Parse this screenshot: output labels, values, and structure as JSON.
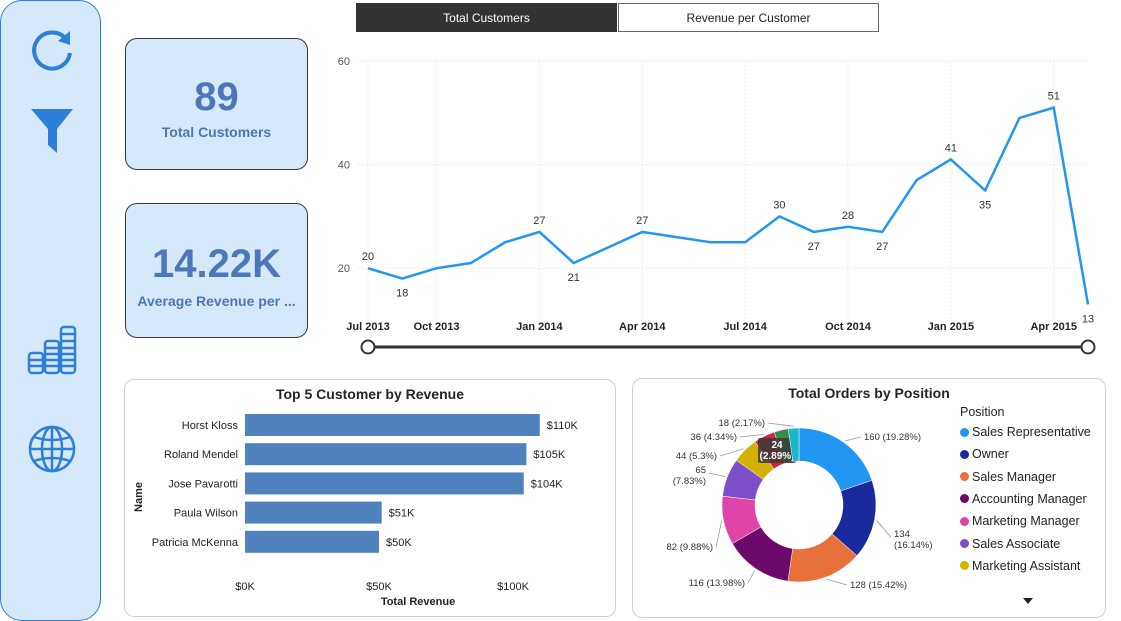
{
  "sidebar": {
    "icons": [
      {
        "name": "refresh-icon"
      },
      {
        "name": "filter-icon"
      },
      {
        "name": "coins-icon"
      },
      {
        "name": "globe-icon"
      }
    ]
  },
  "kpi": {
    "customers": {
      "value": "89",
      "label": "Total Customers"
    },
    "avg_revenue": {
      "value": "14.22K",
      "label": "Average Revenue per ..."
    }
  },
  "tabs": {
    "active": "Total Customers",
    "inactive": "Revenue per Customer"
  },
  "colors": {
    "accent": "#2196f3",
    "card_bg": "#d6e9fb",
    "bar": "#4f81bd",
    "sidebar_icon": "#2d7fd8"
  },
  "chart_data": [
    {
      "type": "line",
      "x": [
        "Jul 2013",
        "Aug 2013",
        "Oct 2013",
        "Nov 2013",
        "Dec 2013",
        "Jan 2014",
        "Feb 2014",
        "Mar 2014",
        "Apr 2014",
        "May 2014",
        "Jun 2014",
        "Jul 2014",
        "Aug 2014",
        "Sep 2014",
        "Oct 2014",
        "Nov 2014",
        "Dec 2014",
        "Jan 2015",
        "Feb 2015",
        "Mar 2015",
        "Apr 2015",
        "May 2015"
      ],
      "values": [
        20,
        18,
        20,
        21,
        25,
        27,
        21,
        24,
        27,
        26,
        25,
        25,
        30,
        27,
        28,
        27,
        37,
        41,
        35,
        49,
        51,
        13
      ],
      "data_labels": [
        20,
        18,
        null,
        null,
        null,
        27,
        21,
        null,
        27,
        null,
        null,
        null,
        30,
        27,
        28,
        27,
        null,
        41,
        35,
        null,
        51,
        13
      ],
      "xticks": [
        "Jul 2013",
        "Oct 2013",
        "Jan 2014",
        "Apr 2014",
        "Jul 2014",
        "Oct 2014",
        "Jan 2015",
        "Apr 2015"
      ],
      "yticks": [
        20,
        40,
        60
      ],
      "ylim": [
        10,
        60
      ],
      "grid": true
    },
    {
      "type": "bar",
      "orientation": "horizontal",
      "title": "Top 5 Customer by Revenue",
      "categories": [
        "Horst Kloss",
        "Roland Mendel",
        "Jose Pavarotti",
        "Paula Wilson",
        "Patricia McKenna"
      ],
      "values": [
        110,
        105,
        104,
        51,
        50
      ],
      "value_labels": [
        "$110K",
        "$105K",
        "$104K",
        "$51K",
        "$50K"
      ],
      "xticks": [
        "$0K",
        "$50K",
        "$100K"
      ],
      "xlabel": "Total Revenue",
      "ylabel": "Name",
      "xlim": [
        0,
        130
      ]
    },
    {
      "type": "pie",
      "donut": true,
      "title": "Total Orders by Position",
      "legend_title": "Position",
      "legend_position": "right",
      "slices": [
        {
          "name": "Sales Representative",
          "value": 160,
          "label": "160 (19.28%)",
          "color": "#2196f3"
        },
        {
          "name": "Owner",
          "value": 134,
          "label": "134 (16.14%)",
          "color": "#1a2a9c"
        },
        {
          "name": "Sales Manager",
          "value": 128,
          "label": "128 (15.42%)",
          "color": "#e8703a"
        },
        {
          "name": "Accounting Manager",
          "value": 116,
          "label": "116 (13.98%)",
          "color": "#6b0a6b"
        },
        {
          "name": "Marketing Manager",
          "value": 82,
          "label": "82 (9.88%)",
          "color": "#e044a8"
        },
        {
          "name": "Sales Associate",
          "value": 65,
          "label": "65 (7.83%)",
          "color": "#7a4fc8"
        },
        {
          "name": "Marketing Assistant",
          "value": 44,
          "label": "44 (5.3%)",
          "color": "#d4b000"
        },
        {
          "name": "",
          "value": 36,
          "label": "36 (4.34%)",
          "color": "#d0263a"
        },
        {
          "name": "",
          "value": 24,
          "label": "24 (2.89%)",
          "color": "#3a8a48"
        },
        {
          "name": "",
          "value": 18,
          "label": "18 (2.17%)",
          "color": "#1ab8c8"
        }
      ]
    }
  ]
}
